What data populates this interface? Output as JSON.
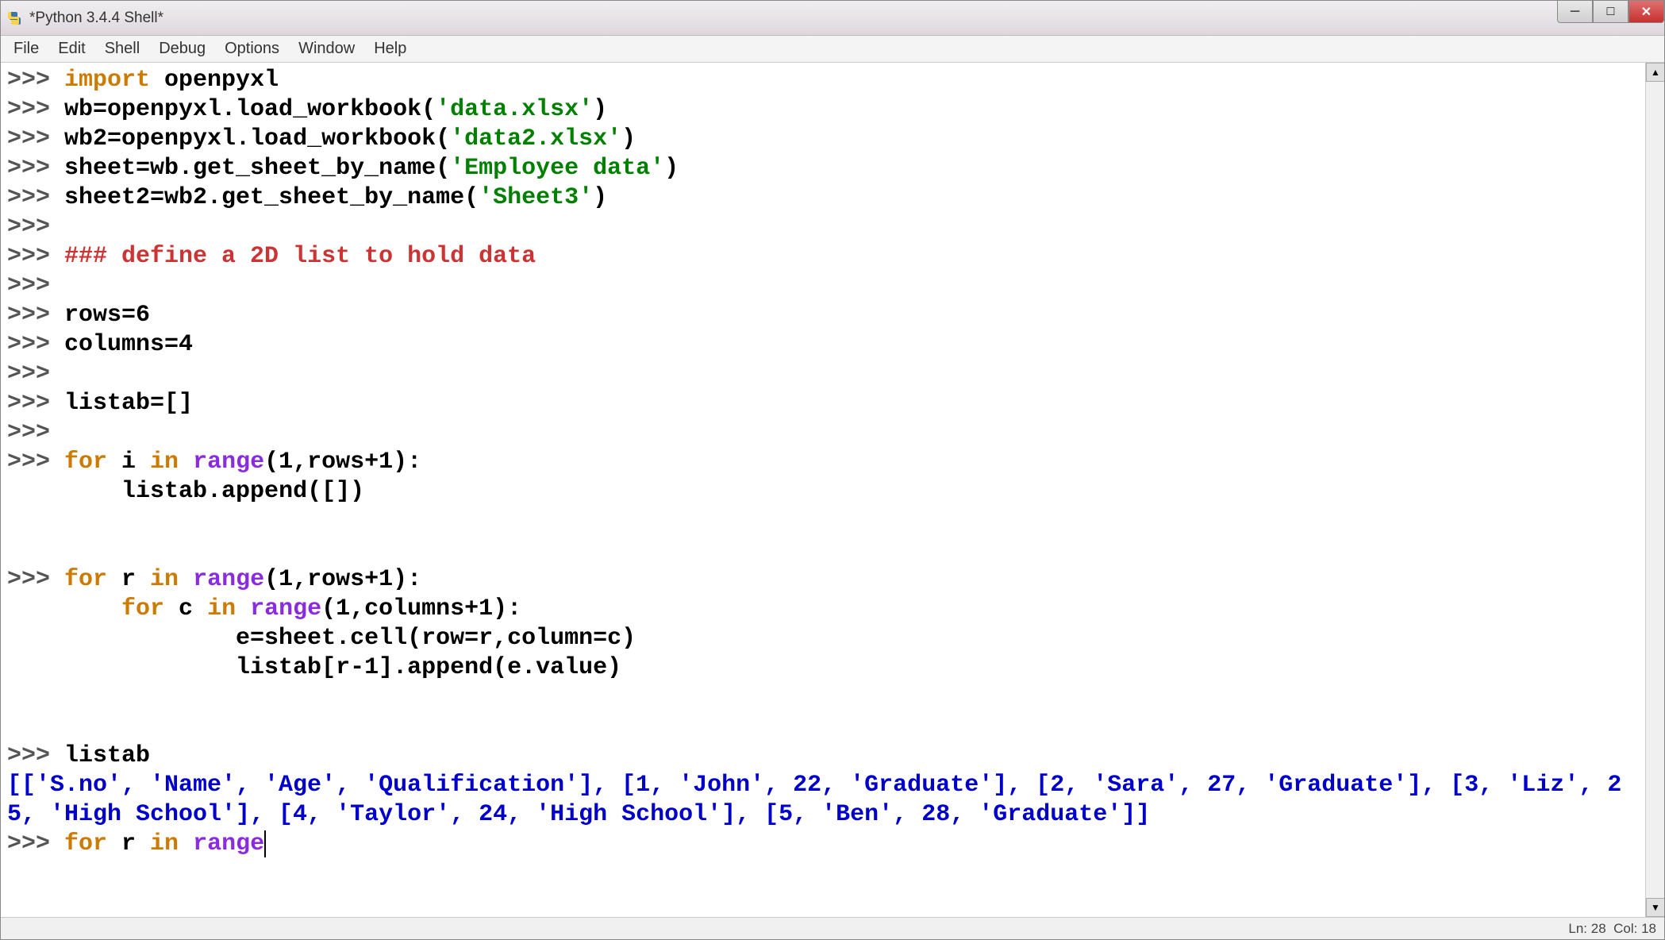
{
  "window": {
    "title": "*Python 3.4.4 Shell*"
  },
  "menubar": {
    "items": [
      "File",
      "Edit",
      "Shell",
      "Debug",
      "Options",
      "Window",
      "Help"
    ]
  },
  "code": {
    "lines": [
      {
        "prompt": ">>> ",
        "parts": [
          {
            "t": "import ",
            "c": "kw-import"
          },
          {
            "t": "openpyxl",
            "c": ""
          }
        ]
      },
      {
        "prompt": ">>> ",
        "parts": [
          {
            "t": "wb=openpyxl.load_workbook(",
            "c": ""
          },
          {
            "t": "'data.xlsx'",
            "c": "str"
          },
          {
            "t": ")",
            "c": ""
          }
        ]
      },
      {
        "prompt": ">>> ",
        "parts": [
          {
            "t": "wb2=openpyxl.load_workbook(",
            "c": ""
          },
          {
            "t": "'data2.xlsx'",
            "c": "str"
          },
          {
            "t": ")",
            "c": ""
          }
        ]
      },
      {
        "prompt": ">>> ",
        "parts": [
          {
            "t": "sheet=wb.get_sheet_by_name(",
            "c": ""
          },
          {
            "t": "'Employee data'",
            "c": "str"
          },
          {
            "t": ")",
            "c": ""
          }
        ]
      },
      {
        "prompt": ">>> ",
        "parts": [
          {
            "t": "sheet2=wb2.get_sheet_by_name(",
            "c": ""
          },
          {
            "t": "'Sheet3'",
            "c": "str"
          },
          {
            "t": ")",
            "c": ""
          }
        ]
      },
      {
        "prompt": ">>> ",
        "parts": []
      },
      {
        "prompt": ">>> ",
        "parts": [
          {
            "t": "### define a 2D list to hold data",
            "c": "comment"
          }
        ]
      },
      {
        "prompt": ">>> ",
        "parts": []
      },
      {
        "prompt": ">>> ",
        "parts": [
          {
            "t": "rows=6",
            "c": ""
          }
        ]
      },
      {
        "prompt": ">>> ",
        "parts": [
          {
            "t": "columns=4",
            "c": ""
          }
        ]
      },
      {
        "prompt": ">>> ",
        "parts": []
      },
      {
        "prompt": ">>> ",
        "parts": [
          {
            "t": "listab=[]",
            "c": ""
          }
        ]
      },
      {
        "prompt": ">>> ",
        "parts": []
      },
      {
        "prompt": ">>> ",
        "parts": [
          {
            "t": "for ",
            "c": "kw-for"
          },
          {
            "t": "i ",
            "c": ""
          },
          {
            "t": "in ",
            "c": "kw-in"
          },
          {
            "t": "range",
            "c": "kw-range"
          },
          {
            "t": "(1,rows+1):",
            "c": ""
          }
        ]
      },
      {
        "prompt": "",
        "parts": [
          {
            "t": "        listab.append([])",
            "c": ""
          }
        ]
      },
      {
        "prompt": "",
        "parts": []
      },
      {
        "prompt": "",
        "parts": [
          {
            "t": "        ",
            "c": ""
          }
        ]
      },
      {
        "prompt": ">>> ",
        "parts": [
          {
            "t": "for ",
            "c": "kw-for"
          },
          {
            "t": "r ",
            "c": ""
          },
          {
            "t": "in ",
            "c": "kw-in"
          },
          {
            "t": "range",
            "c": "kw-range"
          },
          {
            "t": "(1,rows+1):",
            "c": ""
          }
        ]
      },
      {
        "prompt": "",
        "parts": [
          {
            "t": "        ",
            "c": ""
          },
          {
            "t": "for ",
            "c": "kw-for"
          },
          {
            "t": "c ",
            "c": ""
          },
          {
            "t": "in ",
            "c": "kw-in"
          },
          {
            "t": "range",
            "c": "kw-range"
          },
          {
            "t": "(1,columns+1):",
            "c": ""
          }
        ]
      },
      {
        "prompt": "",
        "parts": [
          {
            "t": "                e=sheet.cell(row=r,column=c)",
            "c": ""
          }
        ]
      },
      {
        "prompt": "",
        "parts": [
          {
            "t": "                listab[r-1].append(e.value)",
            "c": ""
          }
        ]
      },
      {
        "prompt": "",
        "parts": []
      },
      {
        "prompt": "",
        "parts": [
          {
            "t": "                ",
            "c": ""
          }
        ]
      },
      {
        "prompt": ">>> ",
        "parts": [
          {
            "t": "listab",
            "c": ""
          }
        ]
      },
      {
        "prompt": "",
        "parts": [
          {
            "t": "[['S.no', 'Name', 'Age', 'Qualification'], [1, 'John', 22, 'Graduate'], [2, 'Sara', 27, 'Graduate'], [3, 'Liz', 25, 'High School'], [4, 'Taylor', 24, 'High School'], [5, 'Ben', 28, 'Graduate']]",
            "c": "output"
          }
        ]
      },
      {
        "prompt": ">>> ",
        "parts": [
          {
            "t": "for ",
            "c": "kw-for"
          },
          {
            "t": "r ",
            "c": ""
          },
          {
            "t": "in ",
            "c": "kw-in"
          },
          {
            "t": "range",
            "c": "kw-range"
          }
        ],
        "cursor": true
      }
    ]
  },
  "statusbar": {
    "line_label": "Ln:",
    "line": "28",
    "col_label": "Col:",
    "col": "18"
  },
  "win_controls": {
    "minimize": "─",
    "maximize": "□",
    "close": "✕"
  },
  "scroll": {
    "up": "▲",
    "down": "▼"
  }
}
